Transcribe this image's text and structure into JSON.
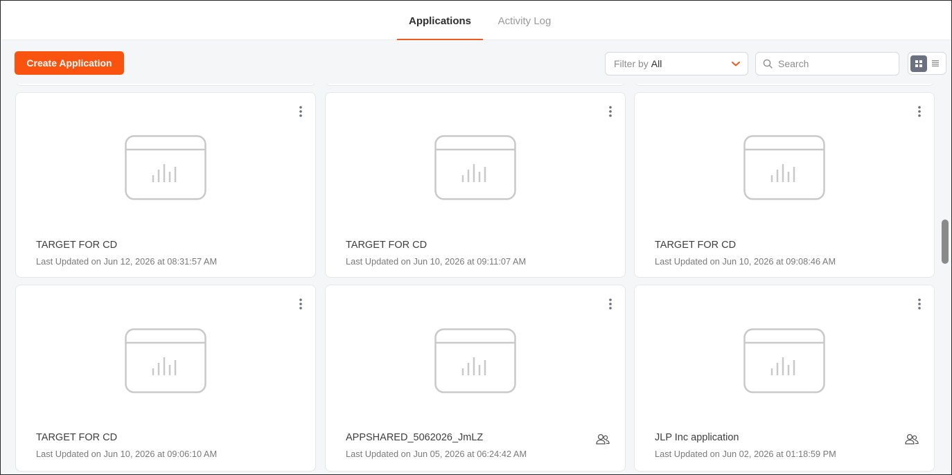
{
  "tabs": [
    {
      "label": "Applications",
      "active": true
    },
    {
      "label": "Activity Log",
      "active": false
    }
  ],
  "toolbar": {
    "create_label": "Create Application",
    "filter_prefix": "Filter by",
    "filter_value": "All",
    "search_placeholder": "Search",
    "view_modes": [
      "grid-view-icon",
      "list-view-icon"
    ],
    "active_view": "grid"
  },
  "colors": {
    "accent": "#fa5310",
    "tab_underline": "#f25a1c",
    "card_bg": "#ffffff",
    "page_bg": "#f5f6f8"
  },
  "apps": [
    {
      "title": "TARGET FOR CD",
      "updated": "Last Updated on Jun 12, 2026 at 08:31:57 AM",
      "shared": false
    },
    {
      "title": "TARGET FOR CD",
      "updated": "Last Updated on Jun 10, 2026 at 09:11:07 AM",
      "shared": false
    },
    {
      "title": "TARGET FOR CD",
      "updated": "Last Updated on Jun 10, 2026 at 09:08:46 AM",
      "shared": false
    },
    {
      "title": "TARGET FOR CD",
      "updated": "Last Updated on Jun 10, 2026 at 09:06:10 AM",
      "shared": false
    },
    {
      "title": "APPSHARED_5062026_JmLZ",
      "updated": "Last Updated on Jun 05, 2026 at 06:24:42 AM",
      "shared": true
    },
    {
      "title": "JLP Inc application",
      "updated": "Last Updated on Jun 02, 2026 at 01:18:59 PM",
      "shared": true
    }
  ]
}
